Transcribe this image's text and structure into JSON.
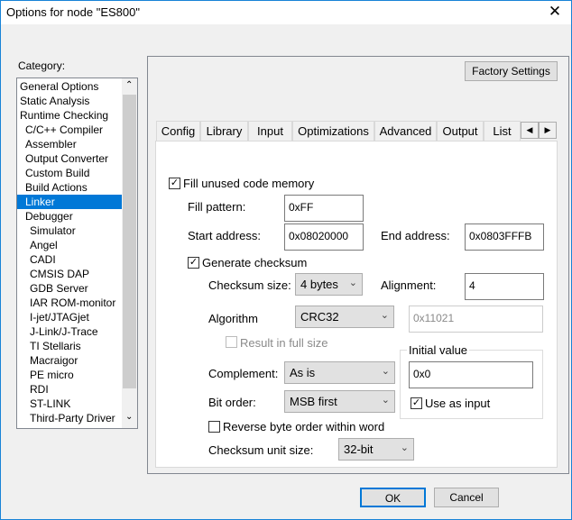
{
  "window": {
    "title": "Options for node \"ES800\"",
    "close": "✕"
  },
  "category": {
    "label": "Category:",
    "items": [
      {
        "label": "General Options",
        "level": 0
      },
      {
        "label": "Static Analysis",
        "level": 0
      },
      {
        "label": "Runtime Checking",
        "level": 0
      },
      {
        "label": "C/C++ Compiler",
        "level": 1
      },
      {
        "label": "Assembler",
        "level": 1
      },
      {
        "label": "Output Converter",
        "level": 1
      },
      {
        "label": "Custom Build",
        "level": 1
      },
      {
        "label": "Build Actions",
        "level": 1
      },
      {
        "label": "Linker",
        "level": 1,
        "selected": true
      },
      {
        "label": "Debugger",
        "level": 1
      },
      {
        "label": "Simulator",
        "level": 2
      },
      {
        "label": "Angel",
        "level": 2
      },
      {
        "label": "CADI",
        "level": 2
      },
      {
        "label": "CMSIS DAP",
        "level": 2
      },
      {
        "label": "GDB Server",
        "level": 2
      },
      {
        "label": "IAR ROM-monitor",
        "level": 2
      },
      {
        "label": "I-jet/JTAGjet",
        "level": 2
      },
      {
        "label": "J-Link/J-Trace",
        "level": 2
      },
      {
        "label": "TI Stellaris",
        "level": 2
      },
      {
        "label": "Macraigor",
        "level": 2
      },
      {
        "label": "PE micro",
        "level": 2
      },
      {
        "label": "RDI",
        "level": 2
      },
      {
        "label": "ST-LINK",
        "level": 2
      },
      {
        "label": "Third-Party Driver",
        "level": 2
      }
    ]
  },
  "factory_settings": "Factory Settings",
  "tabs": [
    "Config",
    "Library",
    "Input",
    "Optimizations",
    "Advanced",
    "Output",
    "List"
  ],
  "form": {
    "fill_unused": "Fill unused code memory",
    "fill_pattern_label": "Fill pattern:",
    "fill_pattern": "0xFF",
    "start_label": "Start address:",
    "start": "0x08020000",
    "end_label": "End address:",
    "end": "0x0803FFFB",
    "gen_checksum": "Generate checksum",
    "cs_size_label": "Checksum size:",
    "cs_size": "4 bytes",
    "align_label": "Alignment:",
    "align": "4",
    "algo_label": "Algorithm",
    "algo": "CRC32",
    "poly": "0x11021",
    "full_size": "Result in full size",
    "init_group": "Initial value",
    "init": "0x0",
    "use_input": "Use as input",
    "complement_label": "Complement:",
    "complement": "As is",
    "bitorder_label": "Bit order:",
    "bitorder": "MSB first",
    "reverse": "Reverse byte order within word",
    "unit_label": "Checksum unit size:",
    "unit": "32-bit"
  },
  "ok": "OK",
  "cancel": "Cancel"
}
